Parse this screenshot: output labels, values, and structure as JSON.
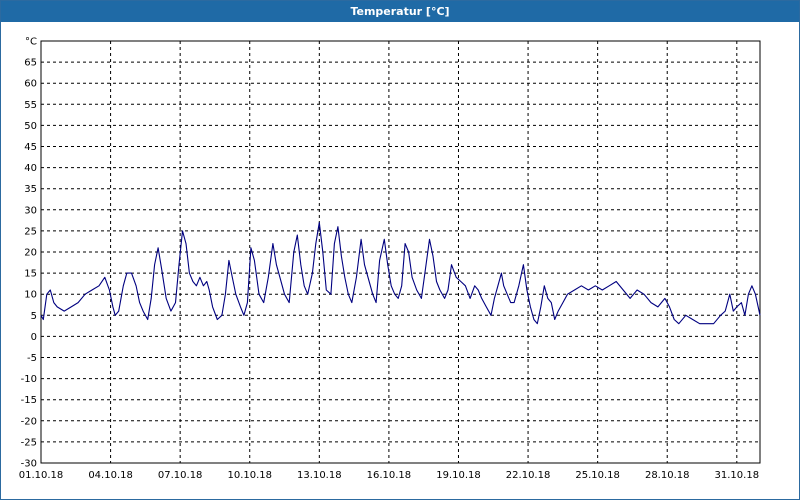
{
  "window": {
    "title": "Temperatur [°C]"
  },
  "chart_data": {
    "type": "line",
    "title": "Temperatur [°C]",
    "y_unit_label": "°C",
    "xlabel": "",
    "ylabel": "",
    "ylim": [
      -30,
      70
    ],
    "y_ticks": [
      65,
      60,
      55,
      50,
      45,
      40,
      35,
      30,
      25,
      20,
      15,
      10,
      5,
      0,
      -5,
      -10,
      -15,
      -20,
      -25,
      -30
    ],
    "x_range_days": [
      1,
      32
    ],
    "x_ticks": [
      {
        "day": 1,
        "label": "01.10.18"
      },
      {
        "day": 4,
        "label": "04.10.18"
      },
      {
        "day": 7,
        "label": "07.10.18"
      },
      {
        "day": 10,
        "label": "10.10.18"
      },
      {
        "day": 13,
        "label": "13.10.18"
      },
      {
        "day": 16,
        "label": "16.10.18"
      },
      {
        "day": 19,
        "label": "19.10.18"
      },
      {
        "day": 22,
        "label": "22.10.18"
      },
      {
        "day": 25,
        "label": "25.10.18"
      },
      {
        "day": 28,
        "label": "28.10.18"
      },
      {
        "day": 31,
        "label": "31.10.18"
      }
    ],
    "grid": true,
    "line_color": "#000080",
    "series": [
      {
        "points": [
          [
            1.0,
            5
          ],
          [
            1.1,
            4
          ],
          [
            1.25,
            10
          ],
          [
            1.4,
            11
          ],
          [
            1.55,
            8
          ],
          [
            1.7,
            7
          ],
          [
            2.0,
            6
          ],
          [
            2.3,
            7
          ],
          [
            2.6,
            8
          ],
          [
            2.9,
            10
          ],
          [
            3.2,
            11
          ],
          [
            3.5,
            12
          ],
          [
            3.75,
            14
          ],
          [
            3.95,
            11
          ],
          [
            4.1,
            7
          ],
          [
            4.2,
            5
          ],
          [
            4.35,
            6
          ],
          [
            4.55,
            12
          ],
          [
            4.7,
            15
          ],
          [
            4.9,
            15
          ],
          [
            5.1,
            12
          ],
          [
            5.25,
            8
          ],
          [
            5.4,
            6
          ],
          [
            5.6,
            4
          ],
          [
            5.75,
            9
          ],
          [
            5.9,
            17
          ],
          [
            6.05,
            21
          ],
          [
            6.2,
            16
          ],
          [
            6.4,
            9
          ],
          [
            6.6,
            6
          ],
          [
            6.8,
            8
          ],
          [
            6.95,
            17
          ],
          [
            7.1,
            25
          ],
          [
            7.25,
            22
          ],
          [
            7.4,
            15
          ],
          [
            7.55,
            13
          ],
          [
            7.7,
            12
          ],
          [
            7.85,
            14
          ],
          [
            8.0,
            12
          ],
          [
            8.15,
            13
          ],
          [
            8.25,
            11
          ],
          [
            8.4,
            7
          ],
          [
            8.6,
            4
          ],
          [
            8.8,
            5
          ],
          [
            8.95,
            10
          ],
          [
            9.1,
            18
          ],
          [
            9.25,
            14
          ],
          [
            9.4,
            10
          ],
          [
            9.6,
            7
          ],
          [
            9.75,
            5
          ],
          [
            9.9,
            8
          ],
          [
            10.05,
            21
          ],
          [
            10.2,
            18
          ],
          [
            10.4,
            10
          ],
          [
            10.6,
            8
          ],
          [
            10.8,
            14
          ],
          [
            11.0,
            22
          ],
          [
            11.15,
            17
          ],
          [
            11.3,
            14
          ],
          [
            11.5,
            10
          ],
          [
            11.7,
            8
          ],
          [
            11.9,
            20
          ],
          [
            12.05,
            24
          ],
          [
            12.2,
            17
          ],
          [
            12.35,
            12
          ],
          [
            12.5,
            10
          ],
          [
            12.7,
            15
          ],
          [
            12.85,
            22
          ],
          [
            13.0,
            27
          ],
          [
            13.15,
            20
          ],
          [
            13.3,
            11
          ],
          [
            13.5,
            10
          ],
          [
            13.65,
            22
          ],
          [
            13.8,
            26
          ],
          [
            13.95,
            19
          ],
          [
            14.1,
            14
          ],
          [
            14.25,
            10
          ],
          [
            14.4,
            8
          ],
          [
            14.6,
            14
          ],
          [
            14.8,
            23
          ],
          [
            14.95,
            17
          ],
          [
            15.1,
            14
          ],
          [
            15.3,
            10
          ],
          [
            15.45,
            8
          ],
          [
            15.6,
            18
          ],
          [
            15.8,
            23
          ],
          [
            15.95,
            17
          ],
          [
            16.1,
            12
          ],
          [
            16.25,
            10
          ],
          [
            16.4,
            9
          ],
          [
            16.55,
            12
          ],
          [
            16.7,
            22
          ],
          [
            16.85,
            20
          ],
          [
            17.0,
            14
          ],
          [
            17.2,
            11
          ],
          [
            17.4,
            9
          ],
          [
            17.55,
            15
          ],
          [
            17.75,
            23
          ],
          [
            17.9,
            19
          ],
          [
            18.05,
            13
          ],
          [
            18.2,
            11
          ],
          [
            18.4,
            9
          ],
          [
            18.55,
            11
          ],
          [
            18.7,
            17
          ],
          [
            18.9,
            14
          ],
          [
            19.1,
            13
          ],
          [
            19.3,
            12
          ],
          [
            19.5,
            9
          ],
          [
            19.7,
            12
          ],
          [
            19.85,
            11
          ],
          [
            20.0,
            9
          ],
          [
            20.2,
            7
          ],
          [
            20.4,
            5
          ],
          [
            20.55,
            9
          ],
          [
            20.7,
            12
          ],
          [
            20.85,
            15
          ],
          [
            20.95,
            12
          ],
          [
            21.1,
            10
          ],
          [
            21.25,
            8
          ],
          [
            21.4,
            8
          ],
          [
            21.6,
            12
          ],
          [
            21.8,
            17
          ],
          [
            21.95,
            11
          ],
          [
            22.1,
            7
          ],
          [
            22.25,
            4
          ],
          [
            22.4,
            3
          ],
          [
            22.55,
            7
          ],
          [
            22.7,
            12
          ],
          [
            22.85,
            9
          ],
          [
            23.0,
            8
          ],
          [
            23.15,
            4
          ],
          [
            23.3,
            6
          ],
          [
            23.5,
            8
          ],
          [
            23.7,
            10
          ],
          [
            24.0,
            11
          ],
          [
            24.3,
            12
          ],
          [
            24.6,
            11
          ],
          [
            24.9,
            12
          ],
          [
            25.2,
            11
          ],
          [
            25.5,
            12
          ],
          [
            25.8,
            13
          ],
          [
            26.1,
            11
          ],
          [
            26.4,
            9
          ],
          [
            26.7,
            11
          ],
          [
            27.0,
            10
          ],
          [
            27.3,
            8
          ],
          [
            27.6,
            7
          ],
          [
            27.9,
            9
          ],
          [
            28.1,
            7
          ],
          [
            28.3,
            4
          ],
          [
            28.5,
            3
          ],
          [
            28.8,
            5
          ],
          [
            29.1,
            4
          ],
          [
            29.4,
            3
          ],
          [
            29.7,
            3
          ],
          [
            30.0,
            3
          ],
          [
            30.3,
            5
          ],
          [
            30.5,
            6
          ],
          [
            30.7,
            10
          ],
          [
            30.85,
            6
          ],
          [
            31.0,
            7
          ],
          [
            31.2,
            8
          ],
          [
            31.35,
            5
          ],
          [
            31.5,
            10
          ],
          [
            31.65,
            12
          ],
          [
            31.8,
            10
          ],
          [
            32.0,
            5
          ]
        ]
      }
    ]
  }
}
